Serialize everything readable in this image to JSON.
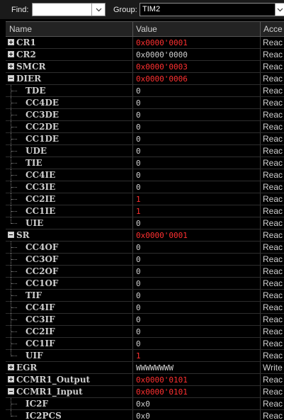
{
  "toolbar": {
    "find_label": "Find:",
    "find_value": "",
    "group_label": "Group:",
    "group_value": "TIM2"
  },
  "columns": {
    "name": "Name",
    "value": "Value",
    "access": "Acce"
  },
  "rows": [
    {
      "name": "CR1",
      "value": "0x0000'0001",
      "access": "Reac",
      "level": 0,
      "toggle": "plus",
      "red": true
    },
    {
      "name": "CR2",
      "value": "0x0000'0000",
      "access": "Reac",
      "level": 0,
      "toggle": "plus",
      "red": false
    },
    {
      "name": "SMCR",
      "value": "0x0000'0003",
      "access": "Reac",
      "level": 0,
      "toggle": "plus",
      "red": true
    },
    {
      "name": "DIER",
      "value": "0x0000'0006",
      "access": "Reac",
      "level": 0,
      "toggle": "minus",
      "red": true
    },
    {
      "name": "TDE",
      "value": "0",
      "access": "Reac",
      "level": 1,
      "red": false
    },
    {
      "name": "CC4DE",
      "value": "0",
      "access": "Reac",
      "level": 1,
      "red": false
    },
    {
      "name": "CC3DE",
      "value": "0",
      "access": "Reac",
      "level": 1,
      "red": false
    },
    {
      "name": "CC2DE",
      "value": "0",
      "access": "Reac",
      "level": 1,
      "red": false
    },
    {
      "name": "CC1DE",
      "value": "0",
      "access": "Reac",
      "level": 1,
      "red": false
    },
    {
      "name": "UDE",
      "value": "0",
      "access": "Reac",
      "level": 1,
      "red": false
    },
    {
      "name": "TIE",
      "value": "0",
      "access": "Reac",
      "level": 1,
      "red": false
    },
    {
      "name": "CC4IE",
      "value": "0",
      "access": "Reac",
      "level": 1,
      "red": false
    },
    {
      "name": "CC3IE",
      "value": "0",
      "access": "Reac",
      "level": 1,
      "red": false
    },
    {
      "name": "CC2IE",
      "value": "1",
      "access": "Reac",
      "level": 1,
      "red": true
    },
    {
      "name": "CC1IE",
      "value": "1",
      "access": "Reac",
      "level": 1,
      "red": true
    },
    {
      "name": "UIE",
      "value": "0",
      "access": "Reac",
      "level": 1,
      "red": false
    },
    {
      "name": "SR",
      "value": "0x0000'0001",
      "access": "Reac",
      "level": 0,
      "toggle": "minus",
      "red": true
    },
    {
      "name": "CC4OF",
      "value": "0",
      "access": "Reac",
      "level": 1,
      "red": false
    },
    {
      "name": "CC3OF",
      "value": "0",
      "access": "Reac",
      "level": 1,
      "red": false
    },
    {
      "name": "CC2OF",
      "value": "0",
      "access": "Reac",
      "level": 1,
      "red": false
    },
    {
      "name": "CC1OF",
      "value": "0",
      "access": "Reac",
      "level": 1,
      "red": false
    },
    {
      "name": "TIF",
      "value": "0",
      "access": "Reac",
      "level": 1,
      "red": false
    },
    {
      "name": "CC4IF",
      "value": "0",
      "access": "Reac",
      "level": 1,
      "red": false
    },
    {
      "name": "CC3IF",
      "value": "0",
      "access": "Reac",
      "level": 1,
      "red": false
    },
    {
      "name": "CC2IF",
      "value": "0",
      "access": "Reac",
      "level": 1,
      "red": false
    },
    {
      "name": "CC1IF",
      "value": "0",
      "access": "Reac",
      "level": 1,
      "red": false
    },
    {
      "name": "UIF",
      "value": "1",
      "access": "Reac",
      "level": 1,
      "red": true
    },
    {
      "name": "EGR",
      "value": "WWWWWWWW",
      "access": "Write",
      "level": 0,
      "toggle": "plus",
      "red": false
    },
    {
      "name": "CCMR1_Output",
      "value": "0x0000'0101",
      "access": "Reac",
      "level": 0,
      "toggle": "plus",
      "red": true
    },
    {
      "name": "CCMR1_Input",
      "value": "0x0000'0101",
      "access": "Reac",
      "level": 0,
      "toggle": "minus",
      "red": true
    },
    {
      "name": "IC2F",
      "value": "0x0",
      "access": "Reac",
      "level": 1,
      "red": false
    },
    {
      "name": "IC2PCS",
      "value": "0x0",
      "access": "Reac",
      "level": 1,
      "red": false
    }
  ],
  "colors": {
    "changed_value": "#ff3030",
    "normal_value": "#d0d0d0",
    "background": "#000000"
  }
}
